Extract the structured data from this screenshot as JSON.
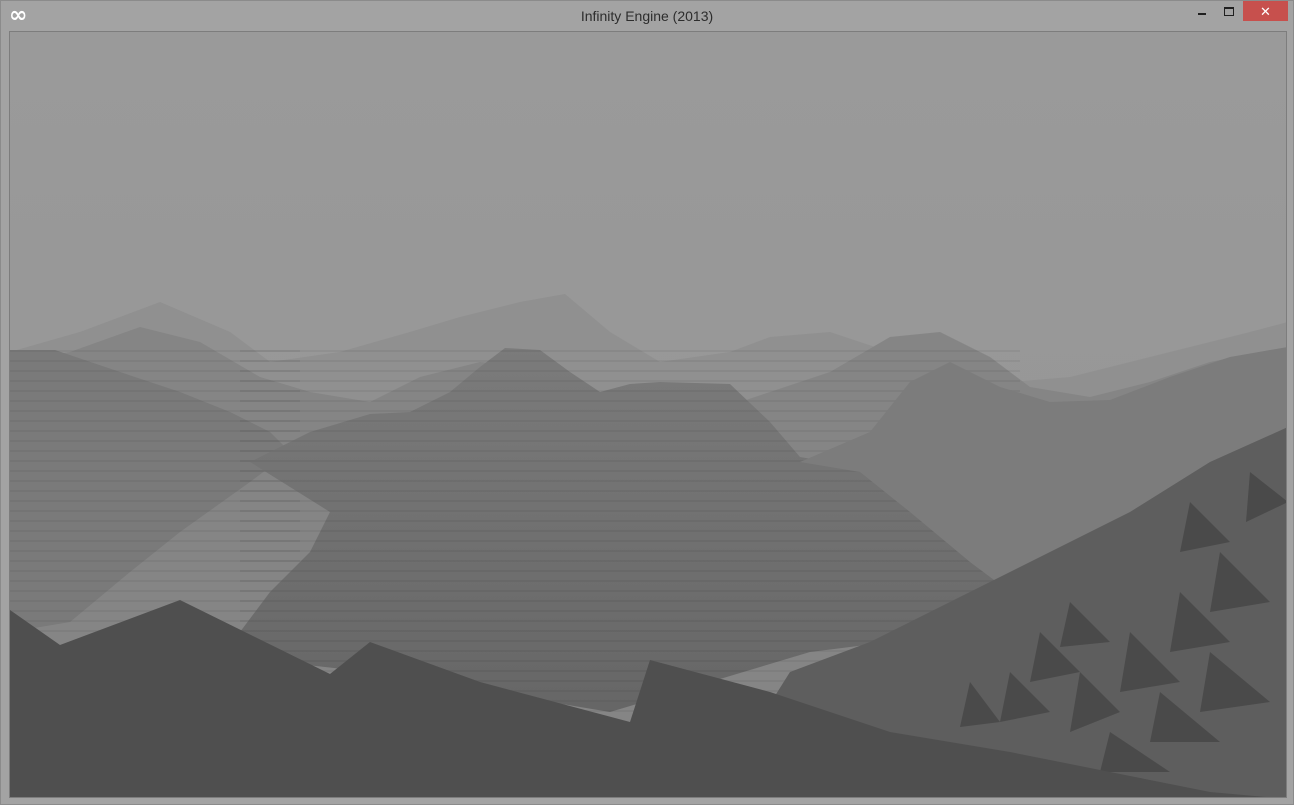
{
  "window": {
    "title": "Infinity Engine (2013)",
    "app_icon_glyph": "∞",
    "controls": {
      "minimize": "minimize-icon",
      "maximize": "maximize-icon",
      "close": "close-icon",
      "close_glyph": "✕"
    }
  },
  "colors": {
    "sky": "#999999",
    "fog_far": "#8f8f8f",
    "terrain_mid": "#6f6f6f",
    "terrain_near": "#4f4f4f",
    "close_button": "#c7504d"
  }
}
